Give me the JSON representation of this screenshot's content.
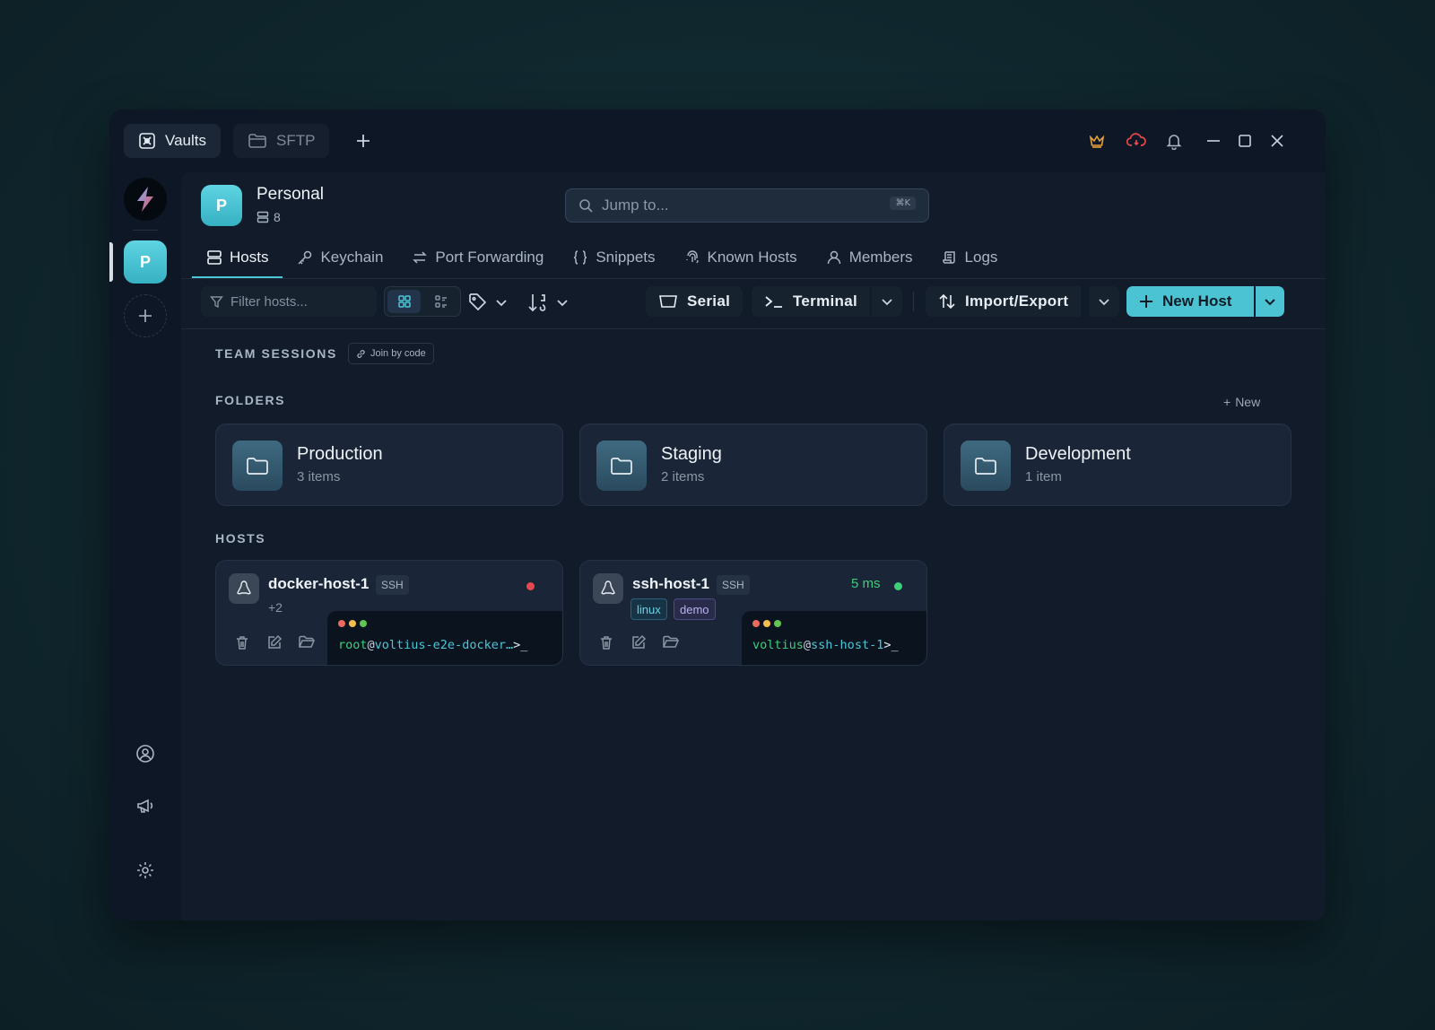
{
  "tabs": [
    {
      "label": "Vaults",
      "icon": "vault-icon"
    },
    {
      "label": "SFTP",
      "icon": "folder-icon"
    }
  ],
  "vault": {
    "initial": "P",
    "name": "Personal",
    "host_count": "8"
  },
  "search": {
    "placeholder": "Jump to...",
    "shortcut": "⌘K"
  },
  "nav": [
    {
      "label": "Hosts",
      "active": true
    },
    {
      "label": "Keychain"
    },
    {
      "label": "Port Forwarding"
    },
    {
      "label": "Snippets"
    },
    {
      "label": "Known Hosts"
    },
    {
      "label": "Members"
    },
    {
      "label": "Logs"
    }
  ],
  "toolbar": {
    "filter_placeholder": "Filter hosts...",
    "serial_label": "Serial",
    "terminal_label": "Terminal",
    "import_export_label": "Import/Export",
    "new_host_label": "New Host"
  },
  "sections": {
    "team_sessions": "TEAM SESSIONS",
    "join_by_code": "Join by code",
    "folders": "FOLDERS",
    "new_label": "New",
    "hosts": "HOSTS"
  },
  "folders": [
    {
      "name": "Production",
      "count": "3 items"
    },
    {
      "name": "Staging",
      "count": "2 items"
    },
    {
      "name": "Development",
      "count": "1 item"
    }
  ],
  "hosts": [
    {
      "name": "docker-host-1",
      "protocol": "SSH",
      "extra_tags": "+2",
      "status": "offline",
      "latency": "",
      "prompt_user": "root",
      "prompt_host": "voltius-e2e-docker…",
      "prompt_suffix": ">_"
    },
    {
      "name": "ssh-host-1",
      "protocol": "SSH",
      "tags": [
        "linux",
        "demo"
      ],
      "status": "online",
      "latency": "5 ms",
      "prompt_user": "voltius",
      "prompt_host": "ssh-host-1",
      "prompt_suffix": ">_"
    }
  ],
  "colors": {
    "accent": "#4cc3d3",
    "online": "#3ccf7a",
    "offline": "#e5484d",
    "crown": "#e6a23c",
    "cloud_alert": "#e5484d"
  }
}
